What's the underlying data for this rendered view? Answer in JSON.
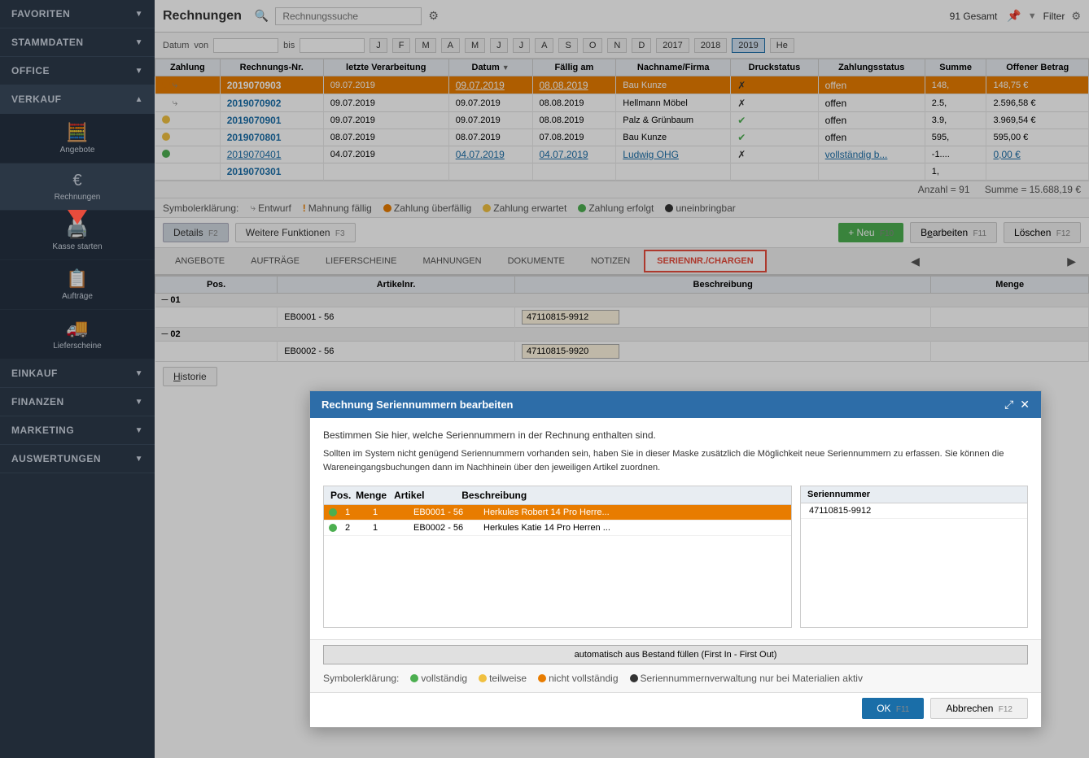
{
  "sidebar": {
    "favoriten_label": "FAVORITEN",
    "stammdaten_label": "STAMMDATEN",
    "office_label": "OFFICE",
    "verkauf_label": "VERKAUF",
    "einkauf_label": "EINKAUF",
    "finanzen_label": "FINANZEN",
    "marketing_label": "MARKETING",
    "auswertungen_label": "AUSWERTUNGEN",
    "nav_items": [
      {
        "icon": "🧮",
        "label": "Angebote"
      },
      {
        "icon": "€",
        "label": "Rechnungen"
      },
      {
        "icon": "🖥️",
        "label": "Kasse starten"
      },
      {
        "icon": "📋",
        "label": "Aufträge"
      },
      {
        "icon": "🚚",
        "label": "Lieferscheine"
      }
    ]
  },
  "topbar": {
    "title": "Rechnungen",
    "search_placeholder": "Rechnungssuche",
    "total_count": "91 Gesamt",
    "filter_label": "Filter"
  },
  "filterbar": {
    "datum_label": "Datum",
    "von_label": "von",
    "bis_label": "bis",
    "month_buttons": [
      "J",
      "F",
      "M",
      "A",
      "M",
      "J",
      "J",
      "A",
      "S",
      "O",
      "N",
      "D"
    ],
    "year_buttons": [
      "2017",
      "2018",
      "2019",
      "He"
    ]
  },
  "table": {
    "headers": [
      "Zahlung",
      "Rechnungs-Nr.",
      "letzte Verarbeitung",
      "Datum ▼",
      "Fällig am",
      "Nachname/Firma",
      "Druckstatus",
      "Zahlungsstatus",
      "Summe",
      "Offener Betrag"
    ],
    "rows": [
      {
        "dot": "orange",
        "icon": "redo",
        "nr": "2019070903",
        "verarbeitung": "09.07.2019",
        "datum": "09.07.2019",
        "faellig": "08.08.2019",
        "name": "Bau Kunze",
        "druck": "✗",
        "zahlung": "offen",
        "summe": "148,",
        "offener": "148,75 €",
        "selected": true
      },
      {
        "dot": "none",
        "icon": "redo",
        "nr": "2019070902",
        "verarbeitung": "09.07.2019",
        "datum": "09.07.2019",
        "faellig": "08.08.2019",
        "name": "Hellmann Möbel",
        "druck": "✗",
        "zahlung": "offen",
        "summe": "2.5,",
        "offener": "2.596,58 €",
        "selected": false
      },
      {
        "dot": "yellow",
        "icon": "",
        "nr": "2019070901",
        "verarbeitung": "09.07.2019",
        "datum": "09.07.2019",
        "faellig": "08.08.2019",
        "name": "Palz & Grünbaum",
        "druck": "✓",
        "zahlung": "offen",
        "summe": "3.9,",
        "offener": "3.969,54 €",
        "selected": false
      },
      {
        "dot": "yellow",
        "icon": "",
        "nr": "2019070801",
        "verarbeitung": "08.07.2019",
        "datum": "08.07.2019",
        "faellig": "07.08.2019",
        "name": "Bau Kunze",
        "druck": "✓",
        "zahlung": "offen",
        "summe": "595,",
        "offener": "595,00 €",
        "selected": false
      },
      {
        "dot": "green",
        "icon": "",
        "nr": "2019070401",
        "verarbeitung": "04.07.2019",
        "datum": "04.07.2019",
        "faellig": "04.07.2019",
        "name": "Ludwig OHG",
        "druck": "✗",
        "zahlung": "vollständig b...",
        "summe": "-1....",
        "offener": "0,00 €",
        "selected": false,
        "link": true
      },
      {
        "dot": "none",
        "icon": "",
        "nr": "2019070301",
        "verarbeitung": "",
        "datum": "",
        "faellig": "",
        "name": "",
        "druck": "",
        "zahlung": "",
        "summe": "1,",
        "offener": "",
        "selected": false
      }
    ],
    "footer_summe": "Summe =",
    "footer_value": "15.688,19 €",
    "footer_anzahl": "Anzahl = 91"
  },
  "symbol_bar": {
    "items": [
      {
        "symbol": "⤷",
        "label": "Entwurf"
      },
      {
        "symbol": "!",
        "label": "Mahnung fällig",
        "color": "orange"
      },
      {
        "symbol": "●",
        "label": "Zahlung überfällig",
        "color": "red"
      },
      {
        "symbol": "●",
        "label": "Zahlung erwartet",
        "color": "yellow"
      },
      {
        "symbol": "●",
        "label": "Zahlung erfolgt",
        "color": "green"
      },
      {
        "symbol": "●",
        "label": "uneinbringbar",
        "color": "black"
      }
    ]
  },
  "action_bar": {
    "details_label": "Details",
    "details_key": "F2",
    "weitere_label": "Weitere Funktionen",
    "weitere_key": "F3",
    "neue_label": "+ Neu",
    "neue_key": "F10",
    "bearbeiten_label": "Bearbeiten",
    "bearbeiten_key": "F11",
    "loeschen_label": "Löschen",
    "loeschen_key": "F12"
  },
  "tabs": {
    "items": [
      {
        "label": "ANGEBOTE",
        "active": false
      },
      {
        "label": "AUFTRÄGE",
        "active": false
      },
      {
        "label": "LIEFERSCHEINE",
        "active": false
      },
      {
        "label": "MAHNUNGEN",
        "active": false
      },
      {
        "label": "DOKUMENTE",
        "active": false
      },
      {
        "label": "NOTIZEN",
        "active": false
      },
      {
        "label": "SERIENNR./CHARGEN",
        "active": true,
        "highlighted": true
      }
    ]
  },
  "sub_table": {
    "headers": [
      "Pos.",
      "Artikelnr.",
      "Beschreibung",
      "Menge"
    ],
    "rows": [
      {
        "group": "01",
        "artikel": "EB0001 - 56",
        "serial": "47110815-9912"
      },
      {
        "group": "02",
        "artikel": "EB0002 - 56",
        "serial": "47110815-9920"
      }
    ]
  },
  "modal": {
    "title": "Rechnung Seriennummern bearbeiten",
    "desc1": "Bestimmen Sie hier, welche Seriennummern in der Rechnung enthalten sind.",
    "desc2": "Sollten im System nicht genügend Seriennummern vorhanden sein, haben Sie in dieser Maske zusätzlich die Möglichkeit neue Seriennummern zu erfassen. Sie können die Wareneingangsbuchungen dann im Nachhinein über den jeweiligen Artikel zuordnen.",
    "left_table_header_cols": [
      "Pos.",
      "Menge",
      "Artikel",
      "Beschreibung"
    ],
    "left_table_rows": [
      {
        "dot": "green",
        "pos": "1",
        "menge": "1",
        "artikel": "EB0001 - 56",
        "beschreibung": "Herkules Robert 14 Pro Herre...",
        "selected": true
      },
      {
        "dot": "green",
        "pos": "2",
        "menge": "1",
        "artikel": "EB0002 - 56",
        "beschreibung": "Herkules Katie 14 Pro Herren ...",
        "selected": false
      }
    ],
    "right_table_header": "Seriennummer",
    "right_table_rows": [
      {
        "serial": "47110815-9912"
      }
    ],
    "auto_btn": "automatisch aus Bestand füllen (First In - First Out)",
    "symbol_bar": [
      {
        "symbol": "●",
        "label": "vollständig",
        "color": "green"
      },
      {
        "symbol": "●",
        "label": "teilweise",
        "color": "yellow"
      },
      {
        "symbol": "●",
        "label": "nicht vollständig",
        "color": "red"
      },
      {
        "symbol": "●",
        "label": "Seriennummernverwaltung nur bei Materialien aktiv",
        "color": "black"
      }
    ],
    "ok_label": "OK",
    "ok_key": "F11",
    "cancel_label": "Abbrechen",
    "cancel_key": "F12"
  },
  "historie_btn": "Historie"
}
